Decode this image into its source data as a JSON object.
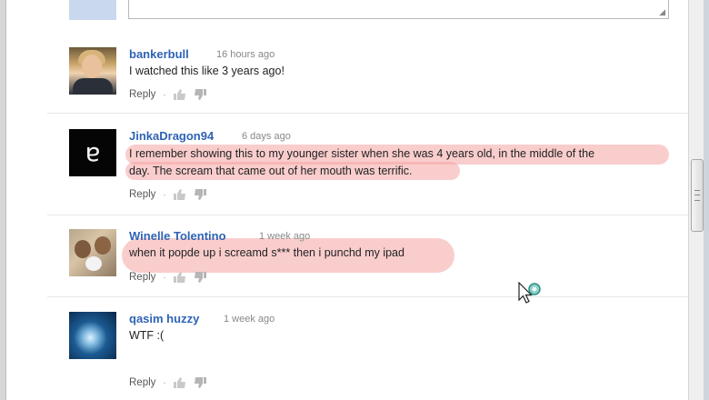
{
  "comments": [
    {
      "username": "bankerbull",
      "timestamp": "16 hours ago",
      "text": "I watched this like 3 years ago!",
      "reply_label": "Reply",
      "separator": "·"
    },
    {
      "username": "JinkaDragon94",
      "timestamp": "6 days ago",
      "text_line1": "I remember showing this to my younger sister when she was 4 years old, in the middle of the",
      "text_line2": "day. The scream that came out of her mouth was terrific.",
      "reply_label": "Reply",
      "separator": "·"
    },
    {
      "username": "Winelle Tolentino",
      "timestamp": "1 week ago",
      "text": "when it popde up i screamd s*** then i punchd my ipad",
      "reply_label": "Reply",
      "separator": "·"
    },
    {
      "username": "qasim huzzy",
      "timestamp": "1 week ago",
      "text": "WTF :(",
      "reply_label": "Reply",
      "separator": "·"
    }
  ],
  "colors": {
    "username": "#2f63b5",
    "highlight": "#f6a4a4"
  },
  "icons": {
    "like": "thumbs-up-icon",
    "dislike": "thumbs-down-icon",
    "cursor": "busy-pointer-icon",
    "jinka_avatar_glyph": "ɐ"
  }
}
